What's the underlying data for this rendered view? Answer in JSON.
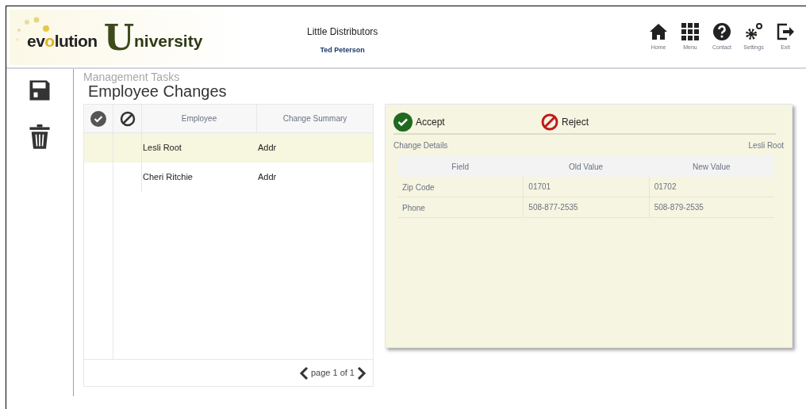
{
  "header": {
    "logo": {
      "word1_start": "ev",
      "word1_o": "o",
      "word1_end": "lution",
      "word2_initial": "U",
      "word2_rest": "niversity"
    },
    "company": "Little Distributors",
    "user": "Ted Peterson",
    "nav": [
      {
        "kind": "home",
        "label": "Home"
      },
      {
        "kind": "menu",
        "label": "Menu"
      },
      {
        "kind": "contact",
        "label": "Contact"
      },
      {
        "kind": "settings",
        "label": "Settings"
      },
      {
        "kind": "exit",
        "label": "Exit"
      }
    ]
  },
  "sidebar": [
    {
      "kind": "save"
    },
    {
      "kind": "delete"
    }
  ],
  "breadcrumb": "Management Tasks",
  "title": "Employee Changes",
  "changes_table": {
    "columns": [
      "Employee",
      "Change Summary"
    ],
    "rows": [
      {
        "employee": "Lesli Root",
        "summary": "Addr",
        "selected": true
      },
      {
        "employee": "Cheri Ritchie",
        "summary": "Addr",
        "selected": false
      }
    ],
    "pager": "page 1 of 1"
  },
  "details": {
    "accept": "Accept",
    "reject": "Reject",
    "heading": "Change Details",
    "employee": "Lesli Root",
    "columns": [
      "Field",
      "Old Value",
      "New Value"
    ],
    "rows": [
      [
        "Zip Code",
        "01701",
        "01702"
      ],
      [
        "Phone",
        "508-877-2535",
        "508-879-2535"
      ]
    ]
  }
}
